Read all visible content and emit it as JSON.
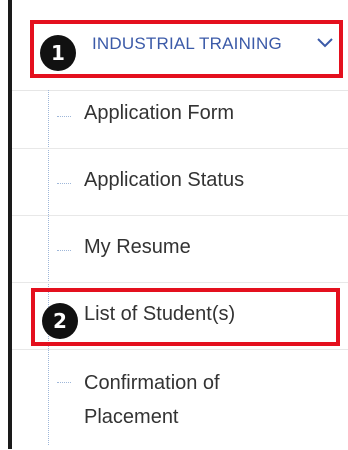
{
  "menu": {
    "section_title": "INDUSTRIAL TRAINING",
    "expand_icon": "chevron-down-icon",
    "items": [
      {
        "label": "Application Form"
      },
      {
        "label": "Application Status"
      },
      {
        "label": "My Resume"
      },
      {
        "label": "List of Student(s)"
      },
      {
        "label": "Confirmation of Placement"
      }
    ]
  },
  "annotations": {
    "step1": "1",
    "step2": "2",
    "highlight_color": "#e4101e"
  },
  "colors": {
    "section_title": "#3b5aa8",
    "item_text": "#333333"
  }
}
